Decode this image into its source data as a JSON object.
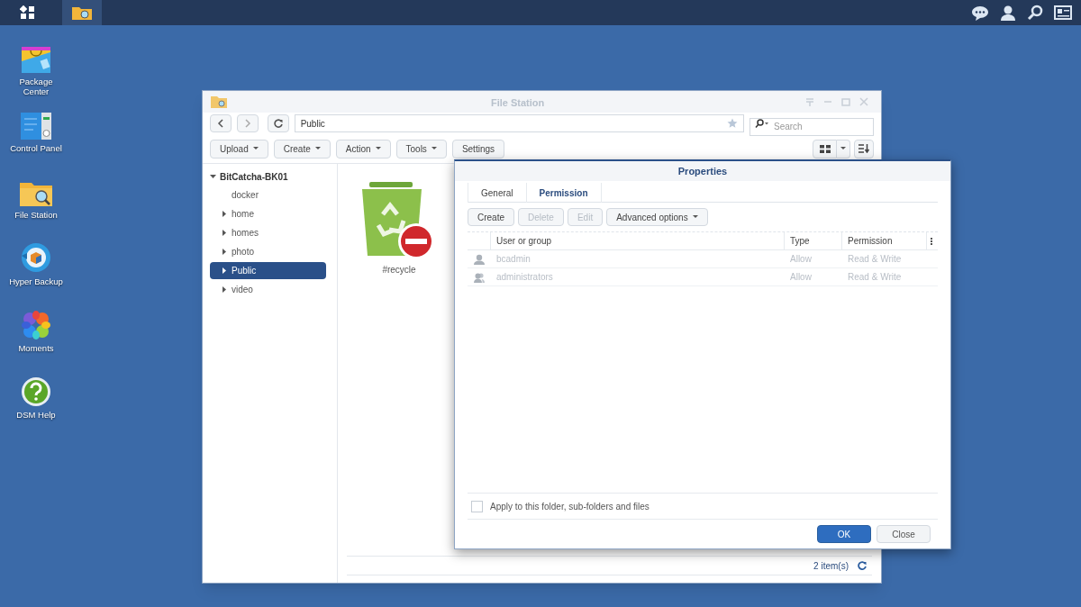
{
  "desktop_icons": [
    {
      "kind": "package",
      "label": "Package\nCenter"
    },
    {
      "kind": "control-panel",
      "label": "Control Panel"
    },
    {
      "kind": "file-station",
      "label": "File Station"
    },
    {
      "kind": "backup",
      "label": "Hyper Backup"
    },
    {
      "kind": "moments",
      "label": "Moments"
    },
    {
      "kind": "help",
      "label": "DSM Help"
    }
  ],
  "file_station": {
    "title": "File Station",
    "path": "Public",
    "search": {
      "placeholder": "Search"
    },
    "toolbar": [
      {
        "label": "Upload",
        "dropdown": true
      },
      {
        "label": "Create",
        "dropdown": true
      },
      {
        "label": "Action",
        "dropdown": true
      },
      {
        "label": "Tools",
        "dropdown": true
      },
      {
        "label": "Settings",
        "dropdown": false
      }
    ],
    "tree": {
      "label": "BitCatcha-BK01",
      "expanded": true,
      "children": [
        {
          "label": "docker",
          "has_children": false,
          "selected": false
        },
        {
          "label": "home",
          "has_children": true,
          "selected": false
        },
        {
          "label": "homes",
          "has_children": true,
          "selected": false
        },
        {
          "label": "photo",
          "has_children": true,
          "selected": false
        },
        {
          "label": "Public",
          "has_children": true,
          "selected": true
        },
        {
          "label": "video",
          "has_children": true,
          "selected": false
        }
      ]
    },
    "files": [
      {
        "name": "#recycle"
      }
    ],
    "status": "2 item(s)"
  },
  "properties": {
    "title": "Properties",
    "tabs": [
      {
        "label": "General",
        "selected": false
      },
      {
        "label": "Permission",
        "selected": true
      }
    ],
    "buttons": [
      {
        "label": "Create",
        "disabled": false,
        "dropdown": false
      },
      {
        "label": "Delete",
        "disabled": true,
        "dropdown": false
      },
      {
        "label": "Edit",
        "disabled": true,
        "dropdown": false
      },
      {
        "label": "Advanced options",
        "disabled": false,
        "dropdown": true
      }
    ],
    "columns": [
      "User or group",
      "Type",
      "Permission"
    ],
    "rows": [
      {
        "kind": "user",
        "name": "bcadmin",
        "type": "Allow",
        "permission": "Read & Write",
        "disabled": true
      },
      {
        "kind": "group",
        "name": "administrators",
        "type": "Allow",
        "permission": "Read & Write",
        "disabled": true
      }
    ],
    "apply_all": {
      "label": "Apply to this folder, sub-folders and files",
      "checked": false
    },
    "footer": [
      {
        "label": "OK",
        "primary": true
      },
      {
        "label": "Close",
        "primary": false
      }
    ]
  }
}
